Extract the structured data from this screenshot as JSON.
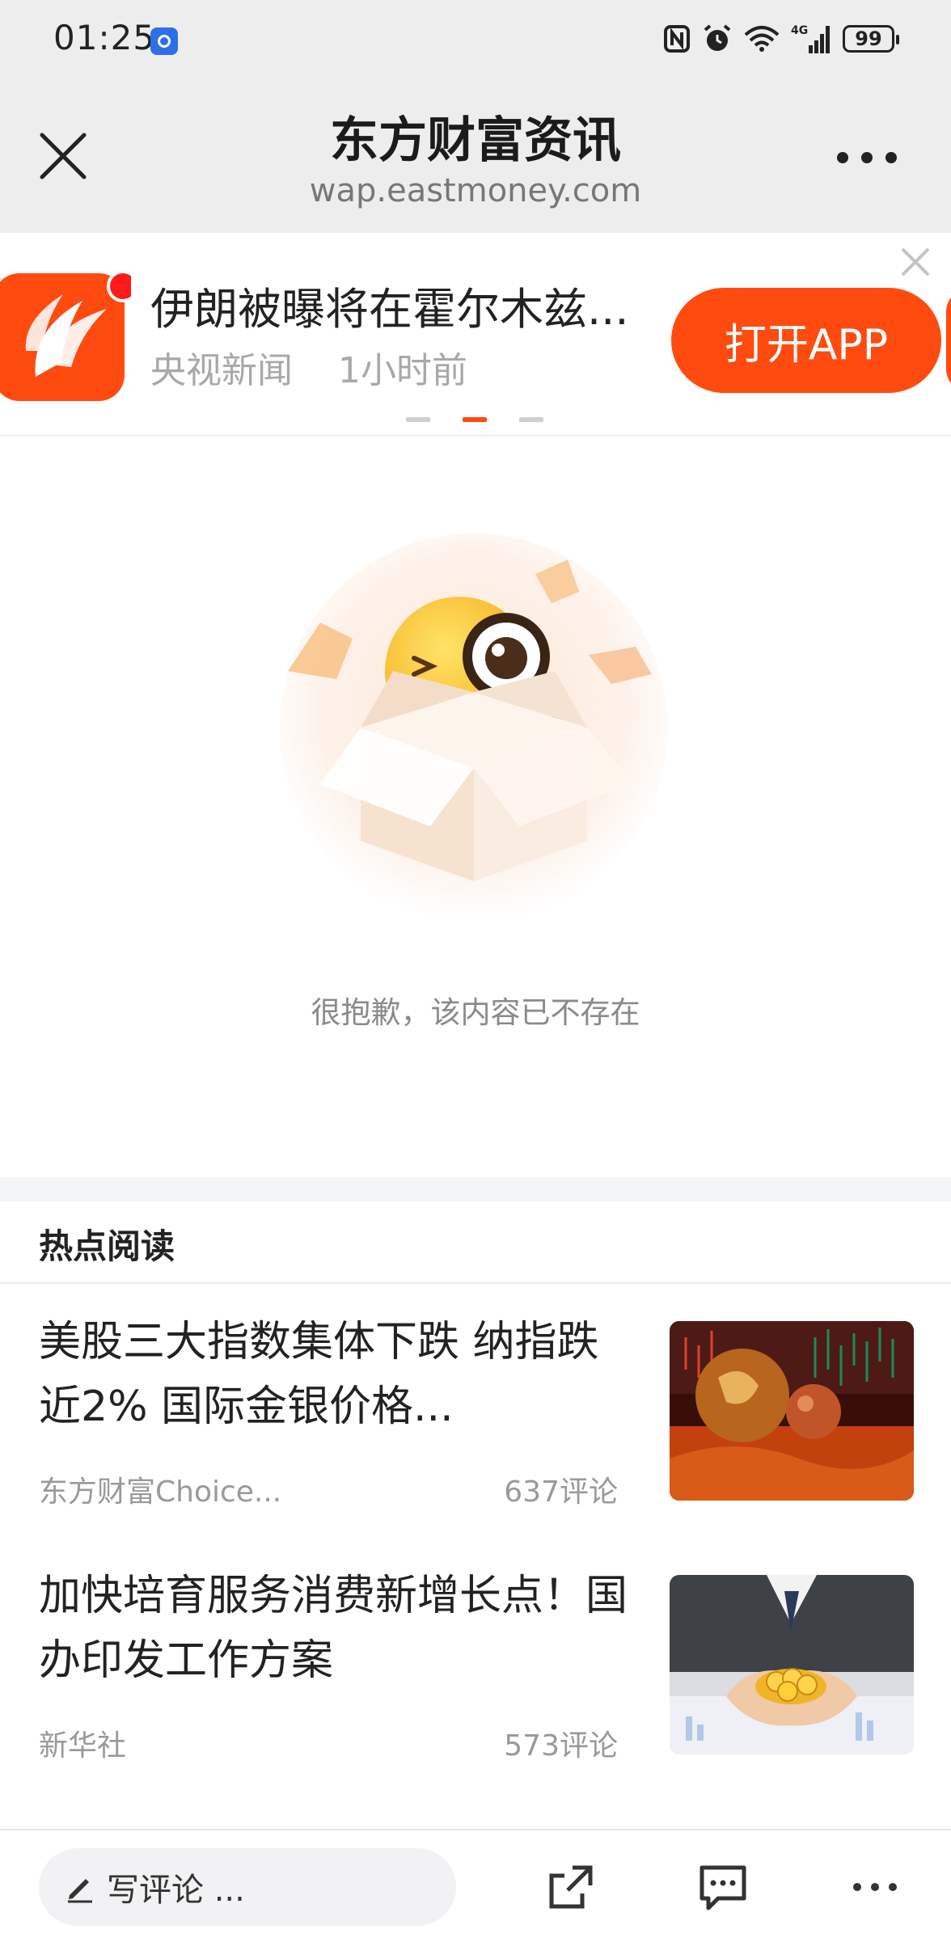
{
  "status_bar": {
    "time": "01:25",
    "network": "4G",
    "battery": "99"
  },
  "title_bar": {
    "title": "东方财富资讯",
    "url": "wap.eastmoney.com"
  },
  "banner": {
    "headline": "伊朗被曝将在霍尔木兹...",
    "source": "央视新闻",
    "time_ago": "1小时前",
    "open_app_label": "打开APP",
    "accent_color": "#ff4b10",
    "carousel_active_index": 2,
    "carousel_count": 3
  },
  "empty_state": {
    "message": "很抱歉，该内容已不存在"
  },
  "hot_reading": {
    "title": "热点阅读",
    "items": [
      {
        "title": "美股三大指数集体下跌 纳指跌近2% 国际金银价格...",
        "source": "东方财富Choice...",
        "comments": "637评论",
        "thumb_icon": "globe-market-thumbnail"
      },
      {
        "title": "加快培育服务消费新增长点！国办印发工作方案",
        "source": "新华社",
        "comments": "573评论",
        "thumb_icon": "gold-coins-thumbnail"
      }
    ]
  },
  "bottom_bar": {
    "comment_placeholder": "写评论 ..."
  }
}
